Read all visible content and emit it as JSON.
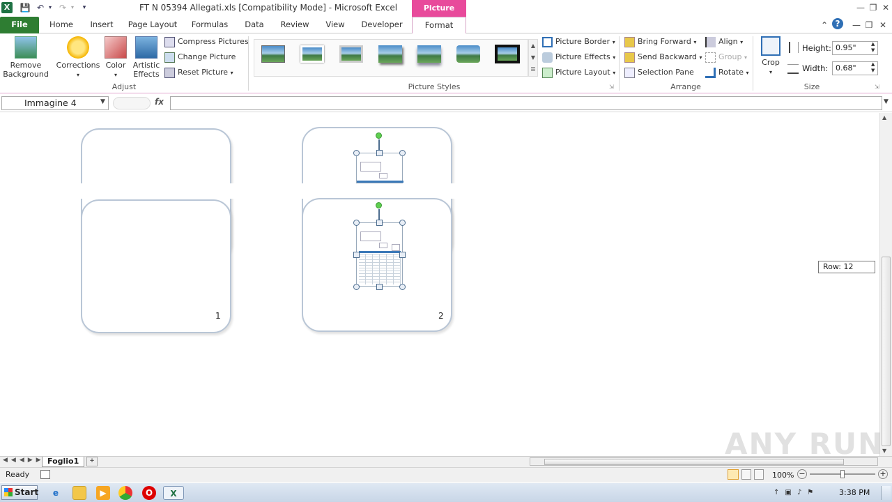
{
  "window": {
    "title": "FT N 05394 Allegati.xls  [Compatibility Mode]  -  Microsoft Excel",
    "context_tab_title": "Picture Tools"
  },
  "tabs": [
    "File",
    "Home",
    "Insert",
    "Page Layout",
    "Formulas",
    "Data",
    "Review",
    "View",
    "Developer",
    "Format"
  ],
  "ribbon": {
    "adjust": {
      "label": "Adjust",
      "remove_background": "Remove Background",
      "corrections": "Corrections",
      "color": "Color",
      "artistic_effects": "Artistic Effects",
      "compress_pictures": "Compress Pictures",
      "change_picture": "Change Picture",
      "reset_picture": "Reset Picture"
    },
    "picture_styles": {
      "label": "Picture Styles",
      "picture_border": "Picture Border",
      "picture_effects": "Picture Effects",
      "picture_layout": "Picture Layout"
    },
    "arrange": {
      "label": "Arrange",
      "bring_forward": "Bring Forward",
      "send_backward": "Send Backward",
      "selection_pane": "Selection Pane",
      "align": "Align",
      "group": "Group",
      "rotate": "Rotate"
    },
    "size": {
      "label": "Size",
      "crop": "Crop",
      "height_label": "Height:",
      "height_value": "0.95\"",
      "width_label": "Width:",
      "width_value": "0.68\""
    }
  },
  "formula_bar": {
    "name_box": "Immagine 4",
    "fx": "fx",
    "formula": ""
  },
  "sheet": {
    "card_numbers": [
      "1",
      "2"
    ],
    "row_tooltip": "Row: 12"
  },
  "sheet_tabs": {
    "active": "Foglio1"
  },
  "status": {
    "ready": "Ready",
    "zoom": "100%"
  },
  "taskbar": {
    "start": "Start",
    "clock": "3:38 PM"
  },
  "watermark": "ANY RUN"
}
